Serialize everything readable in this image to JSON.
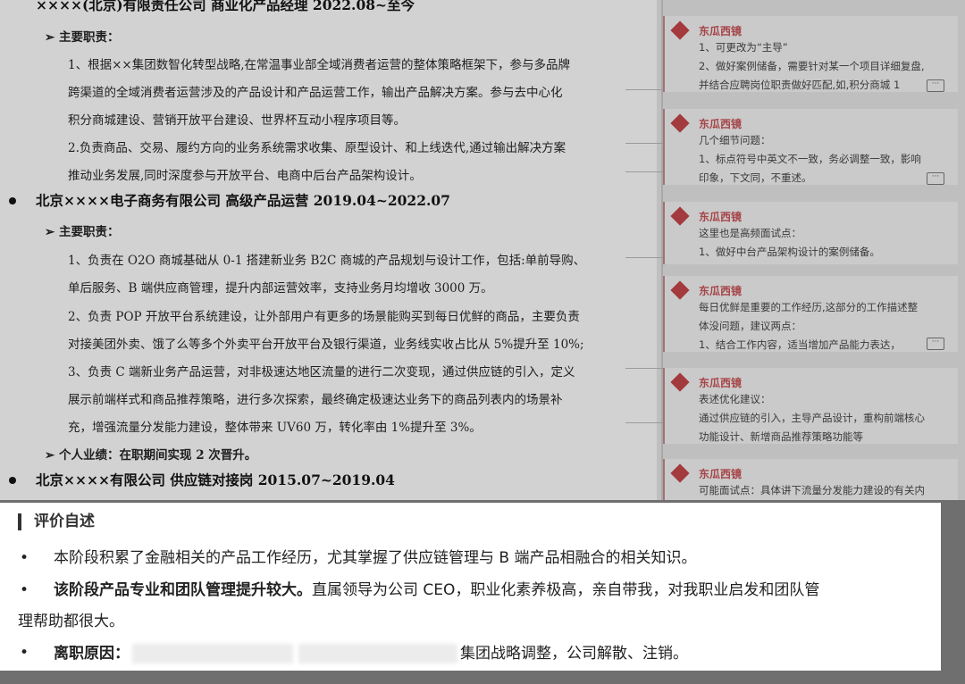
{
  "resume": {
    "job0_title": "××××(北京)有限责任公司  商业化产品经理  2022.08~至今",
    "job0_duties_label": "主要职责：",
    "job0_l1a": "1、根据××集团数智化转型战略,在常温事业部全域消费者运营的整体策略框架下，参与多品牌",
    "job0_l1b": "跨渠道的全域消费者运营涉及的产品设计和产品运营工作，输出产品解决方案。参与去中心化",
    "job0_l1c": "积分商城建设、营销开放平台建设、世界杯互动小程序项目等。",
    "job0_l2a": "2.负责商品、交易、履约方向的业务系统需求收集、原型设计、和上线迭代,通过输出解决方案",
    "job0_l2b": "推动业务发展,同时深度参与开放平台、电商中后台产品架构设计。",
    "job1_title": "北京××××电子商务有限公司  高级产品运营  2019.04~2022.07",
    "job1_duties_label": "主要职责：",
    "job1_l1a": "1、负责在 O2O 商城基础从 0-1 搭建新业务 B2C 商城的产品规划与设计工作，包括:单前导购、",
    "job1_l1b": "单后服务、B 端供应商管理，提升内部运营效率，支持业务月均增收 3000 万。",
    "job1_l2a": "2、负责 POP 开放平台系统建设，让外部用户有更多的场景能购买到每日优鲜的商品，主要负责",
    "job1_l2b": "对接美团外卖、饿了么等多个外卖平台开放平台及银行渠道，业务线实收占比从 5%提升至 10%;",
    "job1_l3a": "3、负责 C 端新业务产品运营，对非极速达地区流量的进行二次变现，通过供应链的引入，定义",
    "job1_l3b": "展示前端样式和商品推荐策略，进行多次探索，最终确定极速达业务下的商品列表内的场景补",
    "job1_l3c": "充，增强流量分发能力建设，整体带来 UV60 万，转化率由 1%提升至 3%。",
    "job1_perf": "个人业绩：在职期间实现 2 次晋升。",
    "job2_title": "北京××××有限公司  供应链对接岗  2015.07~2019.04"
  },
  "comments": [
    {
      "author": "东瓜西镜",
      "lines": [
        "1、可更改为“主导”",
        "2、做好案例储备，需要针对某一个项目详细复盘,",
        "并结合应聘岗位职责做好匹配,如,积分商城 1"
      ]
    },
    {
      "author": "东瓜西镜",
      "lines": [
        "几个细节问题：",
        "1、标点符号中英文不一致，务必调整一致，影响",
        "印象，下文同，不重述。"
      ]
    },
    {
      "author": "东瓜西镜",
      "lines": [
        "这里也是高频面试点：",
        "1、做好中台产品架构设计的案例储备。"
      ]
    },
    {
      "author": "东瓜西镜",
      "lines": [
        "每日优鲜是重要的工作经历,这部分的工作描述整",
        "体没问题，建议两点：",
        "1、结合工作内容，适当增加产品能力表达，"
      ]
    },
    {
      "author": "东瓜西镜",
      "lines": [
        "表述优化建议：",
        "通过供应链的引入，主导产品设计，重构前端核心",
        "功能设计、新增商品推荐策略功能等"
      ]
    },
    {
      "author": "东瓜西镜",
      "lines": [
        "可能面试点：具体讲下流量分发能力建设的有关内"
      ]
    }
  ],
  "more_icon": "···",
  "panel": {
    "heading": "评价自述",
    "bullet": "•",
    "item1": "本阶段积累了金融相关的产品工作经历，尤其掌握了供应链管理与 B 端产品相融合的相关知识。",
    "item2_bold": "该阶段产品专业和团队管理提升较大。",
    "item2_rest": "直属领导为公司 CEO，职业化素养极高，亲自带我，对我职业启发和团队管",
    "item2_cont": "理帮助都很大。",
    "item3_bold": "离职原因：",
    "item3_rest": "集团战略调整，公司解散、注销。"
  }
}
